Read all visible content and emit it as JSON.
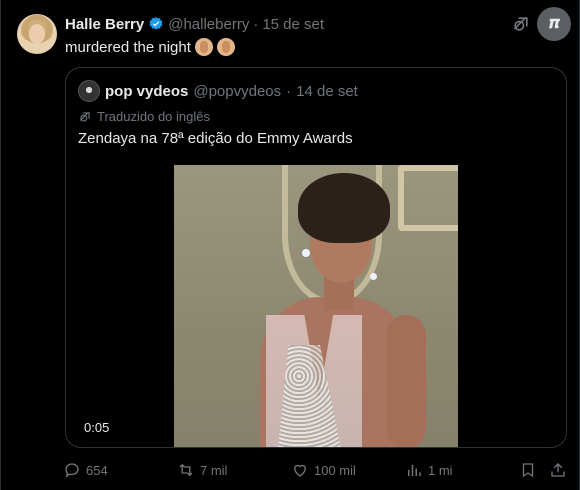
{
  "tweet": {
    "author_name": "Halle Berry",
    "author_handle": "@halleberry",
    "separator": "·",
    "date": "15 de set",
    "text": "murdered the night"
  },
  "quoted": {
    "author_name": "pop vydeos",
    "author_handle": "@popvydeos",
    "separator": "·",
    "date": "14 de set",
    "translated_label": "Traduzido do inglês",
    "text": "Zendaya na 78ª edição do Emmy Awards",
    "video_time": "0:05"
  },
  "actions": {
    "replies": "654",
    "reposts": "7 mil",
    "likes": "100 mil",
    "views": "1 mi"
  },
  "colors": {
    "background": "#000000",
    "text": "#e7e9ea",
    "muted": "#71767b",
    "verified": "#1d9bf0",
    "border": "#2f3336"
  }
}
